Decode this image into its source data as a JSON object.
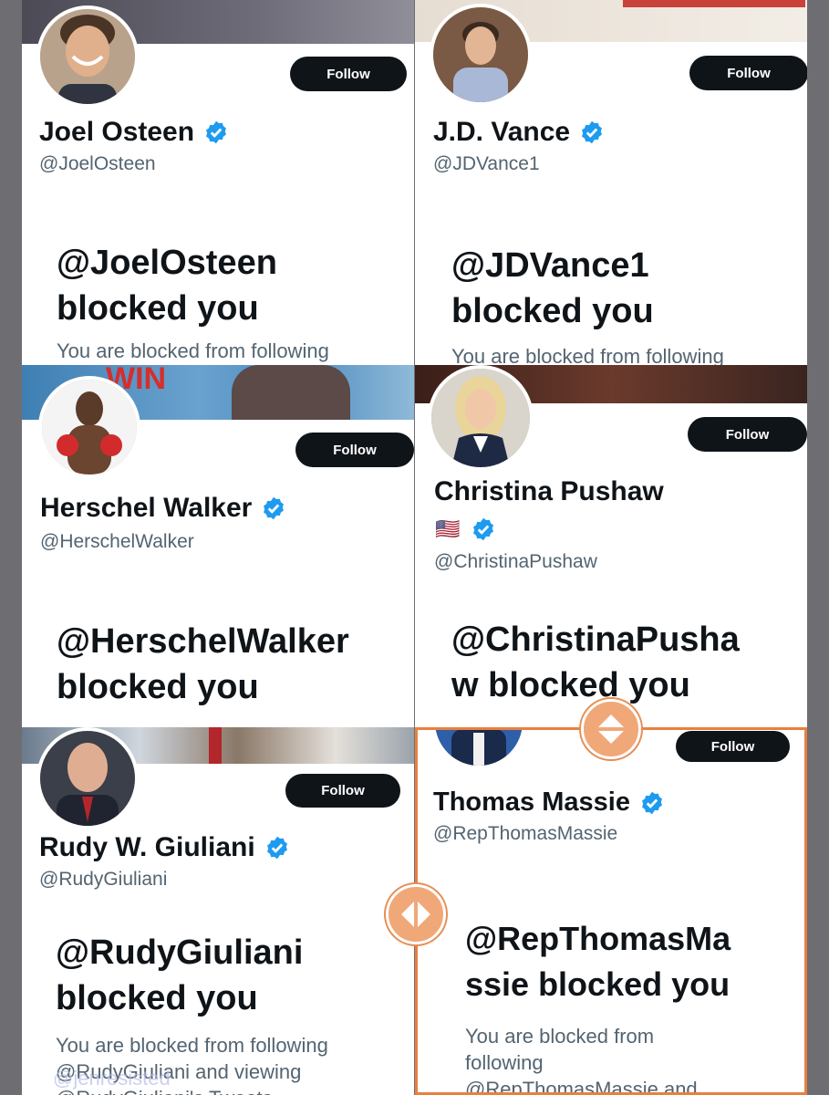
{
  "accent": "#1d9bf0",
  "highlight_color": "#e9803e",
  "follow_label": "Follow",
  "profiles": [
    {
      "name": "Joel Osteen",
      "handle": "@JoelOsteen",
      "blocked_title_1": "@JoelOsteen",
      "blocked_title_2": "blocked you",
      "blocked_sub": "You are blocked from following"
    },
    {
      "name": "J.D. Vance",
      "handle": "@JDVance1",
      "blocked_title_1": "@JDVance1",
      "blocked_title_2": "blocked you",
      "blocked_sub": "You are blocked from following"
    },
    {
      "name": "Herschel Walker",
      "handle": "@HerschelWalker",
      "banner_text": "WIN",
      "blocked_title_1": "@HerschelWalker",
      "blocked_title_2": "blocked you"
    },
    {
      "name": "Christina Pushaw",
      "flag": "🇺🇸",
      "handle": "@ChristinaPushaw",
      "blocked_title_1": "@ChristinaPusha",
      "blocked_title_2": "w blocked you"
    },
    {
      "name": "Rudy W. Giuliani",
      "handle": "@RudyGiuliani",
      "blocked_title_1": "@RudyGiuliani",
      "blocked_title_2": "blocked you",
      "blocked_sub_1": "You are blocked from following",
      "blocked_sub_2": "@RudyGiuliani and viewing",
      "blocked_sub_3": "@RudyGiuliani's Tweets"
    },
    {
      "name": "Thomas Massie",
      "handle": "@RepThomasMassie",
      "blocked_title_1": "@RepThomasMa",
      "blocked_title_2": "ssie blocked you",
      "blocked_sub_1": "You are blocked from",
      "blocked_sub_2": "following",
      "blocked_sub_3": "@RepThomasMassie and"
    }
  ],
  "watermark": "@jenresisted"
}
